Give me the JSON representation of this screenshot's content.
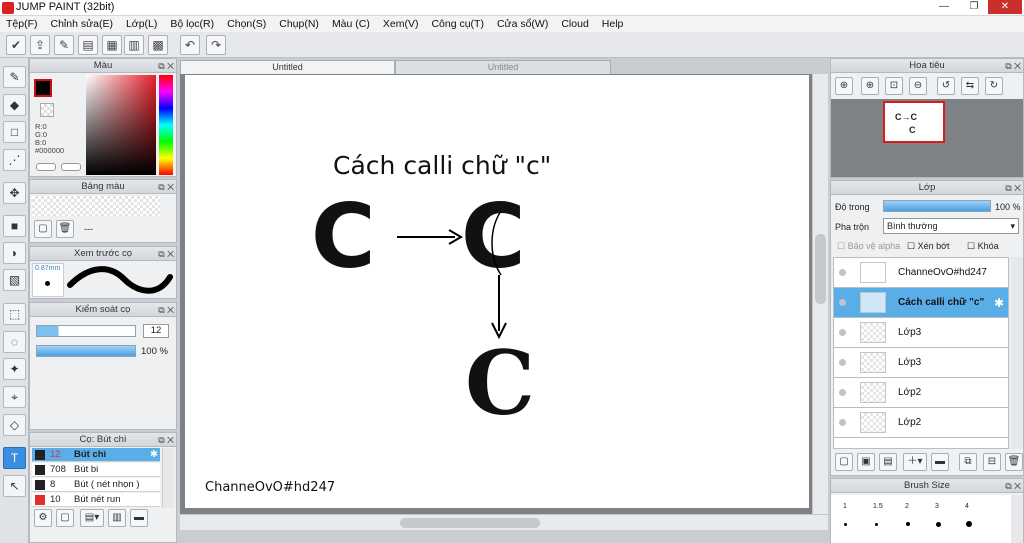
{
  "window": {
    "title": "JUMP PAINT (32bit)"
  },
  "menu": [
    "Tệp(F)",
    "Chỉnh sửa(E)",
    "Lớp(L)",
    "Bộ lọc(R)",
    "Chọn(S)",
    "Chụp(N)",
    "Màu (C)",
    "Xem(V)",
    "Công cụ(T)",
    "Cửa sổ(W)",
    "Cloud",
    "Help"
  ],
  "tabs": [
    "Untitled",
    "Untitled"
  ],
  "color_panel": {
    "title": "Màu",
    "r": "R:0",
    "g": "G:0",
    "b": "B:0",
    "hex": "#000000",
    "primary": "#000000",
    "accent": "#cc1111"
  },
  "swatch_panel": {
    "title": "Bảng màu",
    "dash": "---"
  },
  "brush_preview": {
    "title": "Xem trước cọ",
    "size": "0.87mm"
  },
  "brush_control": {
    "title": "Kiểm soát cọ",
    "size_value": "12",
    "opacity": "100 %"
  },
  "brush_list": {
    "title": "Cọ: Bút chì",
    "items": [
      {
        "size": "12",
        "name": "Bút chì",
        "color": "#222222"
      },
      {
        "size": "708",
        "name": "Bút bi",
        "color": "#222222"
      },
      {
        "size": "8",
        "name": "Bút ( nét nhọn )",
        "color": "#222222"
      },
      {
        "size": "10",
        "name": "Bút nét run",
        "color": "#e03030"
      }
    ]
  },
  "canvas": {
    "heading": "Cách calli chữ \"c\"",
    "signature": "ChanneOvO#hd247",
    "letter": "C"
  },
  "navigator": {
    "title": "Hoa tiêu"
  },
  "layers_panel": {
    "title": "Lớp",
    "opacity_label": "Độ trong",
    "opacity_value": "100 %",
    "blend_label": "Pha trộn",
    "blend_value": "Bình thường",
    "protect_alpha": "Bảo vệ alpha",
    "clip": "Xén bớt",
    "lock": "Khóa",
    "layers": [
      {
        "name": "ChanneOvO#hd247"
      },
      {
        "name": "Cách calli chữ \"c\""
      },
      {
        "name": "Lớp3"
      },
      {
        "name": "Lớp3"
      },
      {
        "name": "Lớp2"
      },
      {
        "name": "Lớp2"
      }
    ]
  },
  "brush_size_panel": {
    "title": "Brush Size",
    "sizes": [
      "1",
      "1.5",
      "2",
      "3",
      "4"
    ]
  }
}
